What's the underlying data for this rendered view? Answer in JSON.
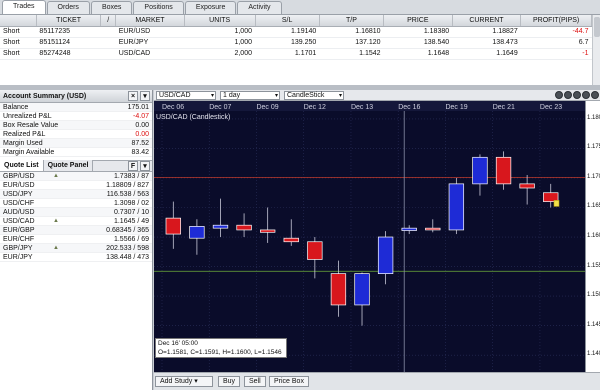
{
  "tabs": [
    "Trades",
    "Orders",
    "Boxes",
    "Positions",
    "Exposure",
    "Activity"
  ],
  "trade_table": {
    "headers": [
      "",
      "TICKET",
      "/",
      "MARKET",
      "UNITS",
      "S/L",
      "T/P",
      "PRICE",
      "CURRENT",
      "PROFIT(PIPS)"
    ],
    "rows": [
      {
        "type": "Short",
        "ticket": "85117235",
        "market": "EUR/USD",
        "units": "1,000",
        "sl": "1.19140",
        "tp": "1.16810",
        "price": "1.18380",
        "current": "1.18827",
        "profit": "-44.7"
      },
      {
        "type": "Short",
        "ticket": "85151124",
        "market": "EUR/JPY",
        "units": "1,000",
        "sl": "139.250",
        "tp": "137.120",
        "price": "138.540",
        "current": "138.473",
        "profit": "6.7"
      },
      {
        "type": "Short",
        "ticket": "85274248",
        "market": "USD/CAD",
        "units": "2,000",
        "sl": "1.1701",
        "tp": "1.1542",
        "price": "1.1648",
        "current": "1.1649",
        "profit": "-1"
      }
    ]
  },
  "account": {
    "title": "Account Summary (USD)",
    "rows": [
      {
        "label": "Balance",
        "value": "175.01",
        "neg": false
      },
      {
        "label": "Unrealized P&L",
        "value": "-4.07",
        "neg": true
      },
      {
        "label": "Box Resale Value",
        "value": "0.00",
        "neg": false
      },
      {
        "label": "Realized P&L",
        "value": "0.00",
        "neg": true
      },
      {
        "label": "Margin Used",
        "value": "87.52",
        "neg": false
      },
      {
        "label": "Margin Available",
        "value": "83.42",
        "neg": false
      }
    ]
  },
  "quote_tabs": [
    "Quote List",
    "Quote Panel"
  ],
  "quotes": [
    {
      "sym": "GBP/USD",
      "val": "1.7383 / 87",
      "mark": true
    },
    {
      "sym": "EUR/USD",
      "val": "1.18809 / 827",
      "mark": false
    },
    {
      "sym": "USD/JPY",
      "val": "116.538 / 563",
      "mark": false
    },
    {
      "sym": "USD/CHF",
      "val": "1.3098 / 02",
      "mark": false
    },
    {
      "sym": "AUD/USD",
      "val": "0.7307 / 10",
      "mark": false
    },
    {
      "sym": "USD/CAD",
      "val": "1.1645 / 49",
      "mark": true
    },
    {
      "sym": "EUR/GBP",
      "val": "0.68345 / 365",
      "mark": false
    },
    {
      "sym": "EUR/CHF",
      "val": "1.5566 / 69",
      "mark": false
    },
    {
      "sym": "GBP/JPY",
      "val": "202.533 / 598",
      "mark": true
    },
    {
      "sym": "EUR/JPY",
      "val": "138.448 / 473",
      "mark": false
    }
  ],
  "chart_toolbar": {
    "instrument": "USD/CAD",
    "interval": "1 day",
    "style": "CandleStick"
  },
  "chart_data": {
    "type": "candlestick",
    "title": "USD/CAD (Candlestick)",
    "x_labels": [
      "Dec 06",
      "Dec 07",
      "Dec 09",
      "Dec 12",
      "Dec 13",
      "Dec 16",
      "Dec 19",
      "Dec 21",
      "Dec 23"
    ],
    "y_ticks": [
      "1.1800",
      "1.1750",
      "1.1700",
      "1.1650",
      "1.1600",
      "1.1550",
      "1.1500",
      "1.1450",
      "1.1400"
    ],
    "ylim": [
      1.1385,
      1.181
    ],
    "hlines": [
      {
        "value": 1.1701,
        "color": "#c0392b"
      },
      {
        "value": 1.1542,
        "color": "#6fae3a"
      }
    ],
    "cursor_date": "Dec 16",
    "candles": [
      {
        "o": 1.1632,
        "h": 1.166,
        "l": 1.158,
        "c": 1.1605
      },
      {
        "o": 1.1598,
        "h": 1.163,
        "l": 1.157,
        "c": 1.1618
      },
      {
        "o": 1.1615,
        "h": 1.1665,
        "l": 1.16,
        "c": 1.162
      },
      {
        "o": 1.162,
        "h": 1.164,
        "l": 1.16,
        "c": 1.1612
      },
      {
        "o": 1.1612,
        "h": 1.165,
        "l": 1.159,
        "c": 1.1608
      },
      {
        "o": 1.1598,
        "h": 1.163,
        "l": 1.1585,
        "c": 1.1592
      },
      {
        "o": 1.1592,
        "h": 1.16,
        "l": 1.153,
        "c": 1.1562
      },
      {
        "o": 1.1538,
        "h": 1.156,
        "l": 1.1465,
        "c": 1.1485
      },
      {
        "o": 1.1485,
        "h": 1.154,
        "l": 1.145,
        "c": 1.1538
      },
      {
        "o": 1.1538,
        "h": 1.161,
        "l": 1.152,
        "c": 1.16
      },
      {
        "o": 1.1611,
        "h": 1.162,
        "l": 1.1605,
        "c": 1.1615
      },
      {
        "o": 1.1615,
        "h": 1.163,
        "l": 1.1608,
        "c": 1.1612
      },
      {
        "o": 1.1612,
        "h": 1.17,
        "l": 1.1605,
        "c": 1.169
      },
      {
        "o": 1.169,
        "h": 1.174,
        "l": 1.167,
        "c": 1.1735
      },
      {
        "o": 1.1735,
        "h": 1.1745,
        "l": 1.168,
        "c": 1.169
      },
      {
        "o": 1.169,
        "h": 1.1705,
        "l": 1.1655,
        "c": 1.1683
      },
      {
        "o": 1.1675,
        "h": 1.169,
        "l": 1.165,
        "c": 1.166
      }
    ]
  },
  "info_box": {
    "line1": "Dec 16' 05:00",
    "line2": "O=1.1581, C=1.1591, H=1.1600, L=1.1546"
  },
  "bottom_buttons": [
    "Add Study",
    "Buy",
    "Sell",
    "Price Box"
  ],
  "colors": {
    "bull": "#1e2bd6",
    "bear": "#d8171d",
    "plot_bg": "#0a0c2a"
  }
}
